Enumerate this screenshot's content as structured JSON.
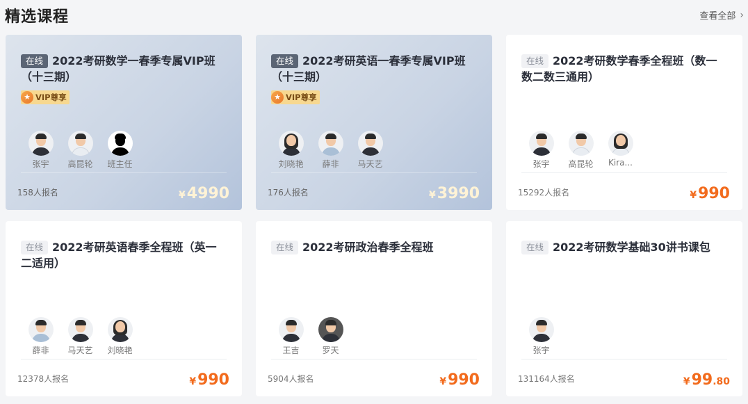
{
  "header": {
    "title": "精选课程",
    "view_all": "查看全部"
  },
  "cards": [
    {
      "badge": "在线",
      "title": "2022考研数学一春季专属VIP班（十三期）",
      "vip": "VIP尊享",
      "teachers": [
        "张宇",
        "高昆轮",
        "班主任"
      ],
      "enrolled": "158人报名",
      "currency": "¥",
      "price": "4990",
      "cents": ""
    },
    {
      "badge": "在线",
      "title": "2022考研英语一春季专属VIP班（十三期）",
      "vip": "VIP尊享",
      "teachers": [
        "刘晓艳",
        "薛非",
        "马天艺"
      ],
      "enrolled": "176人报名",
      "currency": "¥",
      "price": "3990",
      "cents": ""
    },
    {
      "badge": "在线",
      "title": "2022考研数学春季全程班（数一数二数三通用）",
      "vip": "",
      "teachers": [
        "张宇",
        "高昆轮",
        "Kira..."
      ],
      "enrolled": "15292人报名",
      "currency": "¥",
      "price": "990",
      "cents": ""
    },
    {
      "badge": "在线",
      "title": "2022考研英语春季全程班（英一二适用）",
      "vip": "",
      "teachers": [
        "薛非",
        "马天艺",
        "刘晓艳"
      ],
      "enrolled": "12378人报名",
      "currency": "¥",
      "price": "990",
      "cents": ""
    },
    {
      "badge": "在线",
      "title": "2022考研政治春季全程班",
      "vip": "",
      "teachers": [
        "王吉",
        "罗天"
      ],
      "enrolled": "5904人报名",
      "currency": "¥",
      "price": "990",
      "cents": ""
    },
    {
      "badge": "在线",
      "title": "2022考研数学基础30讲书课包",
      "vip": "",
      "teachers": [
        "张宇"
      ],
      "enrolled": "131164人报名",
      "currency": "¥",
      "price": "99",
      "cents": ".80"
    }
  ]
}
